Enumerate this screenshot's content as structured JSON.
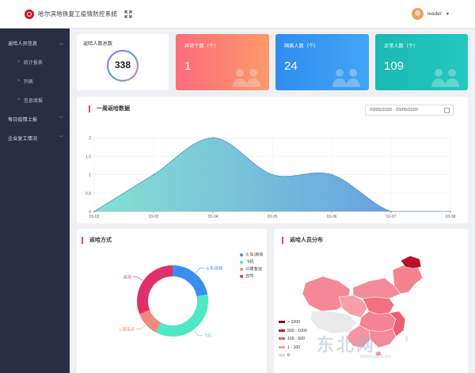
{
  "header": {
    "title": "哈尔滨地铁复工疫情防控系统",
    "user": "leader"
  },
  "sidebar": {
    "items": [
      {
        "label": "返哈人员信息",
        "expanded": true
      },
      {
        "label": "统计报表",
        "sub": true
      },
      {
        "label": "列表",
        "sub": true
      },
      {
        "label": "信息填报",
        "sub": true
      },
      {
        "label": "每日疫情上报",
        "expanded": false
      },
      {
        "label": "企业复工情况",
        "expanded": false
      }
    ]
  },
  "stats": {
    "total_label": "返哈人数总数",
    "total_value": "338",
    "abnormal_label": "异常个数（个）",
    "abnormal_value": "1",
    "isolated_label": "隔离人数（个）",
    "isolated_value": "24",
    "normal_label": "正常人数（个）",
    "normal_value": "109"
  },
  "weekly": {
    "title": "一周返哈数据",
    "date_range": "03/05/2020 - 03/05/2020"
  },
  "mode": {
    "title": "返哈方式",
    "legend": [
      "火车/高铁",
      "飞机",
      "公路客运",
      "自驾"
    ]
  },
  "distribution": {
    "title": "返哈人员分布",
    "legend": [
      "> 1000",
      "500 - 1000",
      "100 - 500",
      "1 - 100",
      "0"
    ]
  },
  "watermark": {
    "main": "东北网",
    "sub": "www.dbw.cn"
  },
  "chart_data": [
    {
      "type": "area",
      "title": "一周返哈数据",
      "x": [
        "03-02",
        "03-03",
        "03-04",
        "03-05",
        "03-06",
        "03-07",
        "03-08"
      ],
      "values": [
        0,
        1,
        2,
        1,
        1,
        0,
        0
      ],
      "ylim": [
        0,
        2
      ],
      "yticks": [
        "0",
        "0.5",
        "1",
        "1.5",
        "2"
      ],
      "grid": true,
      "colors": [
        "#7ee0d0",
        "#5b8fe0"
      ]
    },
    {
      "type": "pie",
      "title": "返哈方式",
      "categories": [
        "火车/高铁",
        "飞机",
        "公路客运",
        "自驾"
      ],
      "values": [
        22,
        36,
        11,
        31
      ],
      "colors": [
        "#3b8ef0",
        "#4ee8c1",
        "#f08a7e",
        "#e0306a"
      ],
      "donut": true
    }
  ],
  "colors": {
    "sidebar": "#2a2e44",
    "accent": "#e64a4a",
    "card_orange": "#fb6c7c",
    "card_blue": "#2f8df0",
    "card_teal": "#1bc0b3"
  }
}
